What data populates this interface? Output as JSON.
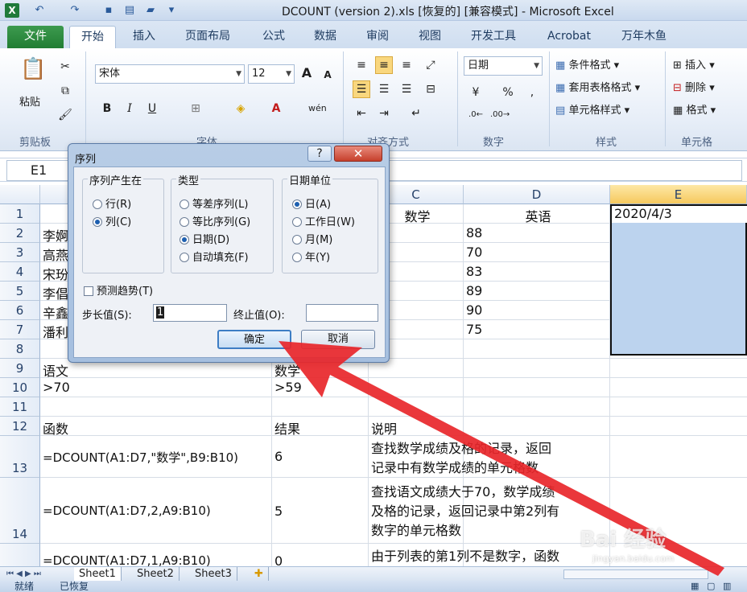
{
  "window": {
    "title": "DCOUNT (version 2).xls [恢复的]  [兼容模式] - Microsoft Excel"
  },
  "tabs": [
    "文件",
    "开始",
    "插入",
    "页面布局",
    "公式",
    "数据",
    "审阅",
    "视图",
    "开发工具",
    "Acrobat",
    "万年木鱼"
  ],
  "ribbon": {
    "clipboard": {
      "paste": "粘贴",
      "label": "剪贴板"
    },
    "font": {
      "name": "宋体",
      "size": "12",
      "label": "字体",
      "bold": "B",
      "italic": "I",
      "underline": "U",
      "grow": "A",
      "shrink": "A",
      "wen": "wén"
    },
    "alignment": {
      "label": "对齐方式"
    },
    "number": {
      "format": "日期",
      "percent": "%",
      "comma": ",",
      "label": "数字"
    },
    "styles": {
      "conditional": "条件格式",
      "table": "套用表格格式",
      "cell": "单元格样式",
      "label": "样式"
    },
    "cells": {
      "insert": "插入",
      "delete": "删除",
      "format": "格式",
      "label": "单元格"
    }
  },
  "formula_bar": {
    "name_box": "E1"
  },
  "columns": [
    "C",
    "D",
    "E"
  ],
  "rows": [
    "1",
    "2",
    "3",
    "4",
    "5",
    "6",
    "7",
    "8",
    "9",
    "10",
    "11",
    "12",
    "13",
    "14"
  ],
  "cells": {
    "C1": "数学",
    "D1": "英语",
    "E1": "2020/4/3",
    "A2": "李婀",
    "A3": "高燕",
    "A4": "宋玢",
    "A5": "李倡",
    "A6": "辛鑫",
    "A7": "潘利",
    "D2": "88",
    "D3": "70",
    "D4": "83",
    "D5": "89",
    "D6": "90",
    "D7": "75",
    "A9": "语文",
    "B9": "数学",
    "A10": ">70",
    "B10": ">59",
    "A12": "函数",
    "B12": "结果",
    "C12": "说明",
    "A13": "=DCOUNT(A1:D7,\"数学\",B9:B10)",
    "B13": "6",
    "C13a": "查找数学成绩及格的记录，返回",
    "C13b": "记录中有数学成绩的单元格数",
    "A14": "=DCOUNT(A1:D7,2,A9:B10)",
    "B14": "5",
    "C14a": "查找语文成绩大于70，数学成绩",
    "C14b": "及格的记录，返回记录中第2列有",
    "C14c": "数字的单元格数",
    "A15": "=DCOUNT(A1:D7,1,A9:B10)",
    "B15": "0",
    "C15": "由于列表的第1列不是数字，函数"
  },
  "sheets": [
    "Sheet1",
    "Sheet2",
    "Sheet3"
  ],
  "status": {
    "ready": "就绪",
    "recovered": "已恢复"
  },
  "dialog": {
    "title": "序列",
    "help": "?",
    "close": "✕",
    "series_in": {
      "label": "序列产生在",
      "options": [
        "行(R)",
        "列(C)"
      ],
      "selected": 1
    },
    "type": {
      "label": "类型",
      "options": [
        "等差序列(L)",
        "等比序列(G)",
        "日期(D)",
        "自动填充(F)"
      ],
      "selected": 2
    },
    "date_unit": {
      "label": "日期单位",
      "options": [
        "日(A)",
        "工作日(W)",
        "月(M)",
        "年(Y)"
      ],
      "selected": 0
    },
    "trend": "预测趋势(T)",
    "step_label": "步长值(S):",
    "step_value": "1",
    "stop_label": "终止值(O):",
    "stop_value": "",
    "ok": "确定",
    "cancel": "取消"
  },
  "watermark": {
    "text": "Bai 经验",
    "sub": "jingyan.baidu.com"
  },
  "colors": {
    "accent": "#217d33",
    "selection": "#bcd3ee",
    "arrow": "#e8262a"
  }
}
